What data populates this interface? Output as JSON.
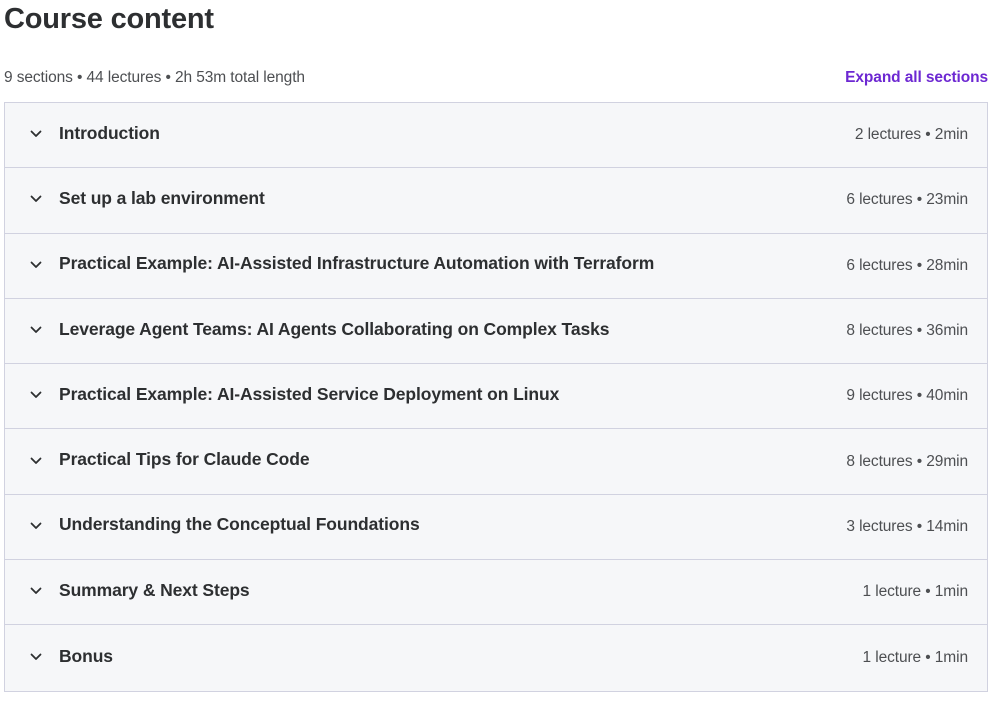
{
  "header": {
    "title": "Course content"
  },
  "summary": {
    "text": "9 sections • 44 lectures • 2h 53m total length",
    "expand_all_label": "Expand all sections"
  },
  "colors": {
    "accent": "#6d28d2",
    "text": "#2d2f31",
    "muted": "#4d4f52",
    "row_background": "#f6f7f9",
    "border": "#d1d2e0"
  },
  "icons": {
    "row_toggle": "chevron-down-icon"
  },
  "sections": [
    {
      "title": "Introduction",
      "meta": "2 lectures • 2min"
    },
    {
      "title": "Set up a lab environment",
      "meta": "6 lectures • 23min"
    },
    {
      "title": "Practical Example: AI-Assisted Infrastructure Automation with Terraform",
      "meta": "6 lectures • 28min"
    },
    {
      "title": "Leverage Agent Teams: AI Agents Collaborating on Complex Tasks",
      "meta": "8 lectures • 36min"
    },
    {
      "title": "Practical Example: AI-Assisted Service Deployment on Linux",
      "meta": "9 lectures • 40min"
    },
    {
      "title": "Practical Tips for Claude Code",
      "meta": "8 lectures • 29min"
    },
    {
      "title": "Understanding the Conceptual Foundations",
      "meta": "3 lectures • 14min"
    },
    {
      "title": "Summary & Next Steps",
      "meta": "1 lecture • 1min"
    },
    {
      "title": "Bonus",
      "meta": "1 lecture • 1min"
    }
  ]
}
